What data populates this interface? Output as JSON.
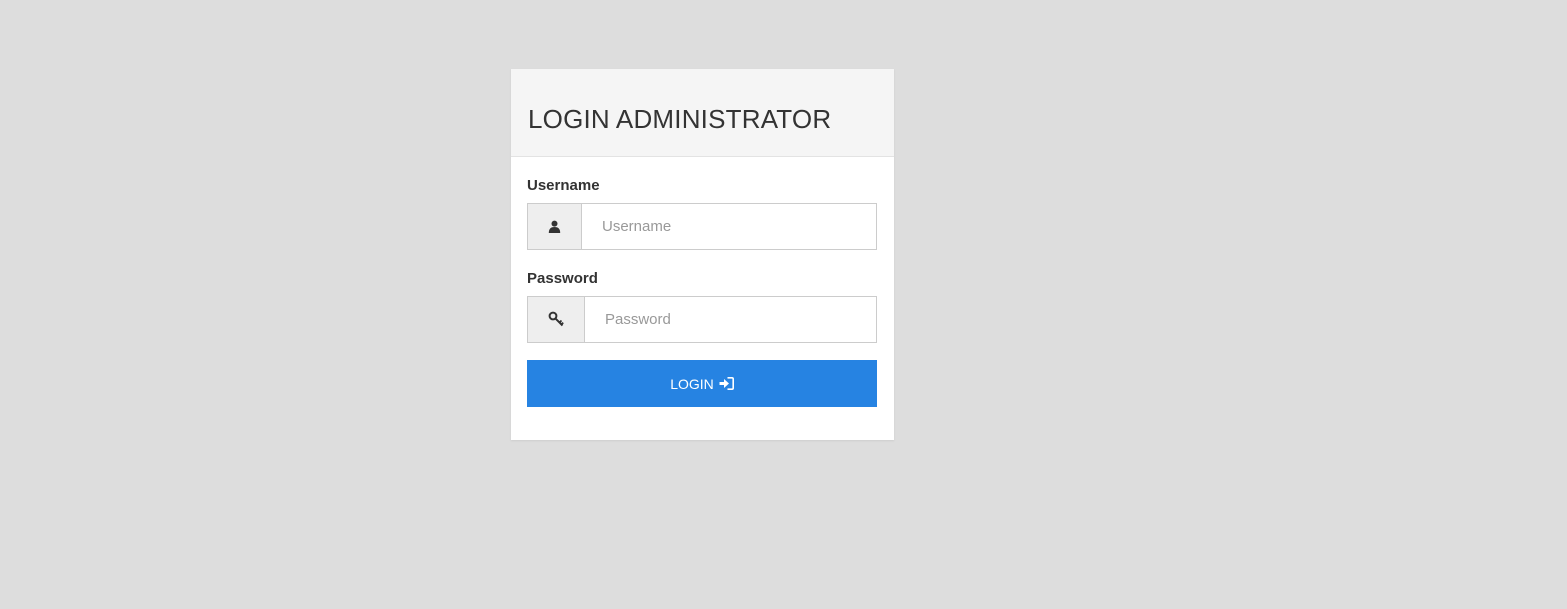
{
  "panel": {
    "title": "LOGIN ADMINISTRATOR"
  },
  "username": {
    "label": "Username",
    "placeholder": "Username",
    "icon": "user-icon"
  },
  "password": {
    "label": "Password",
    "placeholder": "Password",
    "icon": "key-icon"
  },
  "login_button": {
    "label": "LOGIN",
    "icon": "sign-in-icon"
  },
  "colors": {
    "background": "#dddddd",
    "button": "#2683e2",
    "header": "#f5f5f5"
  }
}
